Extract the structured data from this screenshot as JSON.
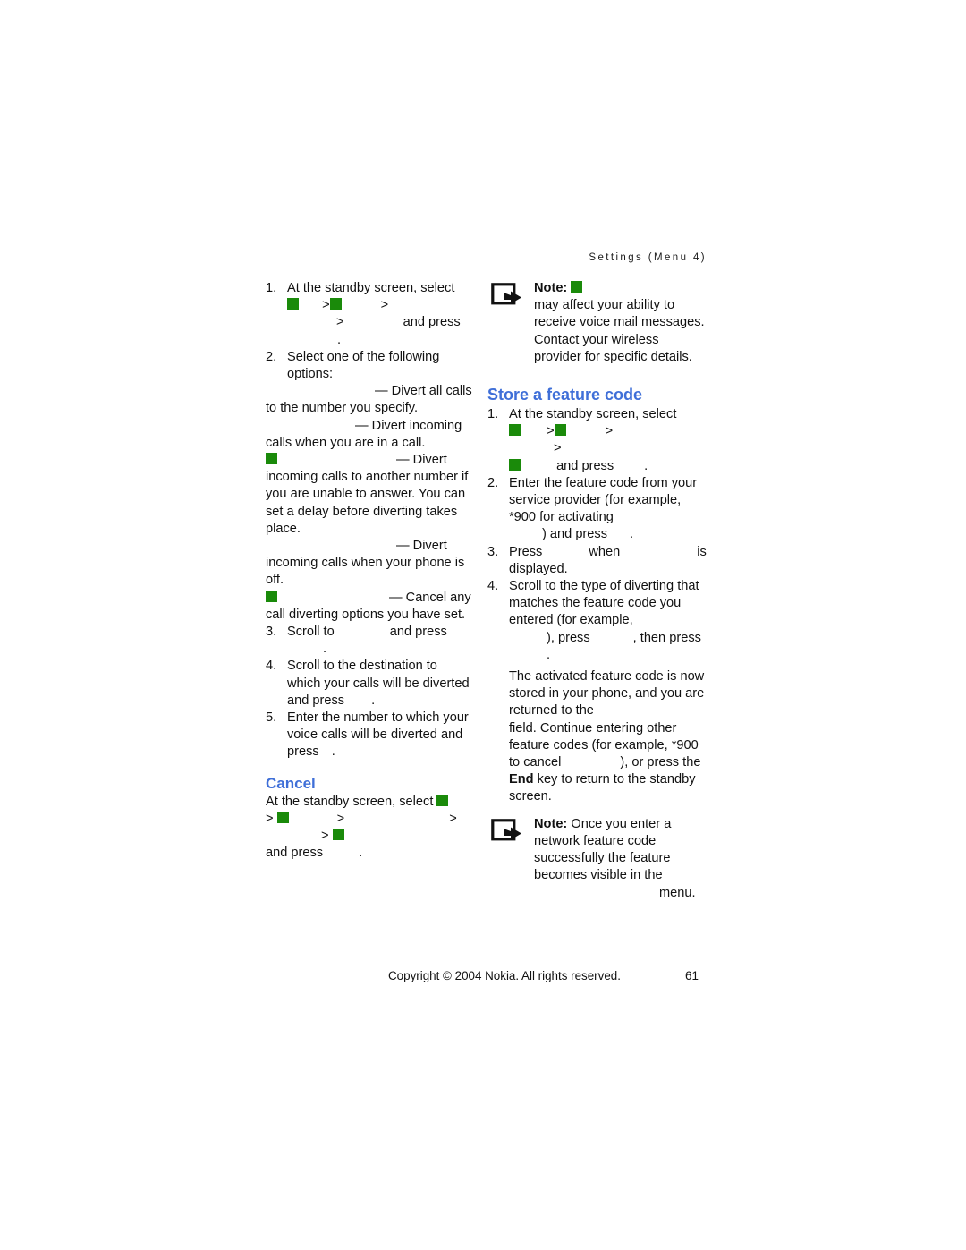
{
  "header": {
    "running_head": "Settings (Menu 4)"
  },
  "left_column": {
    "step1": {
      "num": "1.",
      "text_a": "At the standby screen, select",
      "sep1": ">",
      "sep2": ">",
      "sep3": ">",
      "text_b": "and press",
      "period": "."
    },
    "step2": {
      "num": "2.",
      "text": "Select one of the following options:",
      "options": [
        {
          "dash": "— Divert all calls",
          "rest": "to the number you specify."
        },
        {
          "dash": "— Divert incoming",
          "rest": "calls when you are in a call."
        },
        {
          "dash": "— Divert",
          "rest": "incoming calls to another number if you are unable to answer. You can set a delay before diverting takes place."
        },
        {
          "dash": "— Divert",
          "rest": "incoming calls when your phone is off."
        },
        {
          "dash": "— Cancel",
          "rest": "any call diverting options you have set."
        }
      ]
    },
    "step3": {
      "num": "3.",
      "text_a": "Scroll to",
      "text_b": "and press",
      "period": "."
    },
    "step4": {
      "num": "4.",
      "text_a": "Scroll to the destination to which your calls will be diverted and press",
      "period": "."
    },
    "step5": {
      "num": "5.",
      "text_a": "Enter the number to which your voice calls will be diverted and press",
      "period": "."
    },
    "cancel_heading": "Cancel",
    "cancel_body": {
      "text_a": "At the standby screen, select",
      "sep1": ">",
      "sep2": ">",
      "sep3": ">",
      "sep4": ">",
      "text_b": "and press",
      "period": "."
    }
  },
  "right_column": {
    "note1": {
      "label": "Note:",
      "text": "may affect your ability to receive voice mail messages. Contact your wireless provider for specific details."
    },
    "heading": "Store a feature code",
    "step1": {
      "num": "1.",
      "text_a": "At the standby screen, select",
      "sep1": ">",
      "sep2": ">",
      "sep3": ">",
      "text_b": "and press",
      "period": "."
    },
    "step2": {
      "num": "2.",
      "text_a": "Enter the feature code from your service provider (for example, *900 for activating",
      "text_b": ") and press",
      "period": "."
    },
    "step3": {
      "num": "3.",
      "text_a": "Press",
      "text_b": "when",
      "text_c": "is displayed.",
      "period": "."
    },
    "step4": {
      "num": "4.",
      "text_a": "Scroll to the type of diverting that matches the feature code you entered (for example,",
      "text_b": "), press",
      "text_c": ", then press",
      "period": "."
    },
    "result_para": {
      "text_a": "The activated feature code is now stored in your phone, and you are returned to the",
      "text_b": "field. Continue entering other feature codes (for example, *900 to cancel",
      "text_c": "), or press the",
      "bold_end": "End",
      "text_d": "key to return to the standby screen."
    },
    "note2": {
      "label": "Note:",
      "text_a": "Once you enter a network feature code successfully the feature becomes visible in the",
      "text_b": "menu."
    }
  },
  "footer": {
    "copyright": "Copyright © 2004 Nokia. All rights reserved.",
    "page_number": "61"
  },
  "colors": {
    "heading_blue": "#3f6fd8",
    "missing_glyph_green": "#1a8a0a",
    "text": "#111111"
  },
  "icons": {
    "note": "note-arrow-icon"
  }
}
